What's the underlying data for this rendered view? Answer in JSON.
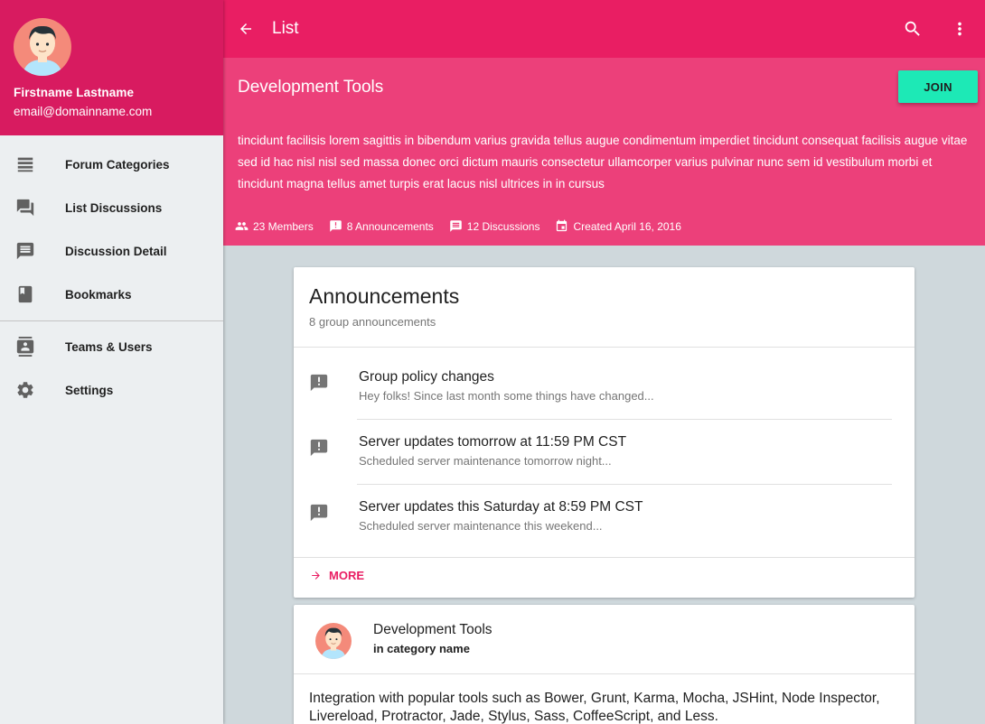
{
  "profile": {
    "name": "Firstname Lastname",
    "email": "email@domainname.com"
  },
  "nav": {
    "items": [
      {
        "label": "Forum Categories",
        "icon": "view-list-icon"
      },
      {
        "label": "List Discussions",
        "icon": "forum-icon"
      },
      {
        "label": "Discussion Detail",
        "icon": "message-icon"
      },
      {
        "label": "Bookmarks",
        "icon": "book-icon"
      }
    ],
    "items2": [
      {
        "label": "Teams & Users",
        "icon": "contacts-icon"
      },
      {
        "label": "Settings",
        "icon": "gear-icon"
      }
    ]
  },
  "toolbar": {
    "title": "List"
  },
  "group": {
    "title": "Development Tools",
    "join_label": "JOIN",
    "description": "tincidunt facilisis lorem sagittis in bibendum varius gravida tellus augue condimentum imperdiet tincidunt consequat facilisis augue vitae sed id hac nisl nisl sed massa donec orci dictum mauris consectetur ullamcorper varius pulvinar nunc sem id vestibulum morbi et tincidunt magna tellus amet turpis erat lacus nisl ultrices in in cursus",
    "stats": {
      "members": "23 Members",
      "announcements": "8 Announcements",
      "discussions": "12 Discussions",
      "created": "Created April 16, 2016"
    }
  },
  "announcements": {
    "title": "Announcements",
    "subtitle": "8 group announcements",
    "items": [
      {
        "title": "Group policy changes",
        "desc": "Hey folks! Since last month some things have changed..."
      },
      {
        "title": "Server updates tomorrow at 11:59 PM CST",
        "desc": "Scheduled server maintenance tomorrow night..."
      },
      {
        "title": "Server updates this Saturday at 8:59 PM CST",
        "desc": "Scheduled server maintenance this weekend..."
      }
    ],
    "more_label": "MORE"
  },
  "dev_card": {
    "title": "Development Tools",
    "category": "in category name",
    "body": "Integration with popular tools such as Bower, Grunt, Karma, Mocha, JSHint, Node Inspector, Livereload, Protractor, Jade, Stylus, Sass, CoffeeScript, and Less."
  },
  "colors": {
    "primary": "#e91e63",
    "primary_dark": "#d81b60",
    "header": "#ec407a",
    "accent": "#1de9b6",
    "background": "#cfd8dc",
    "sidebar": "#eceff1"
  }
}
